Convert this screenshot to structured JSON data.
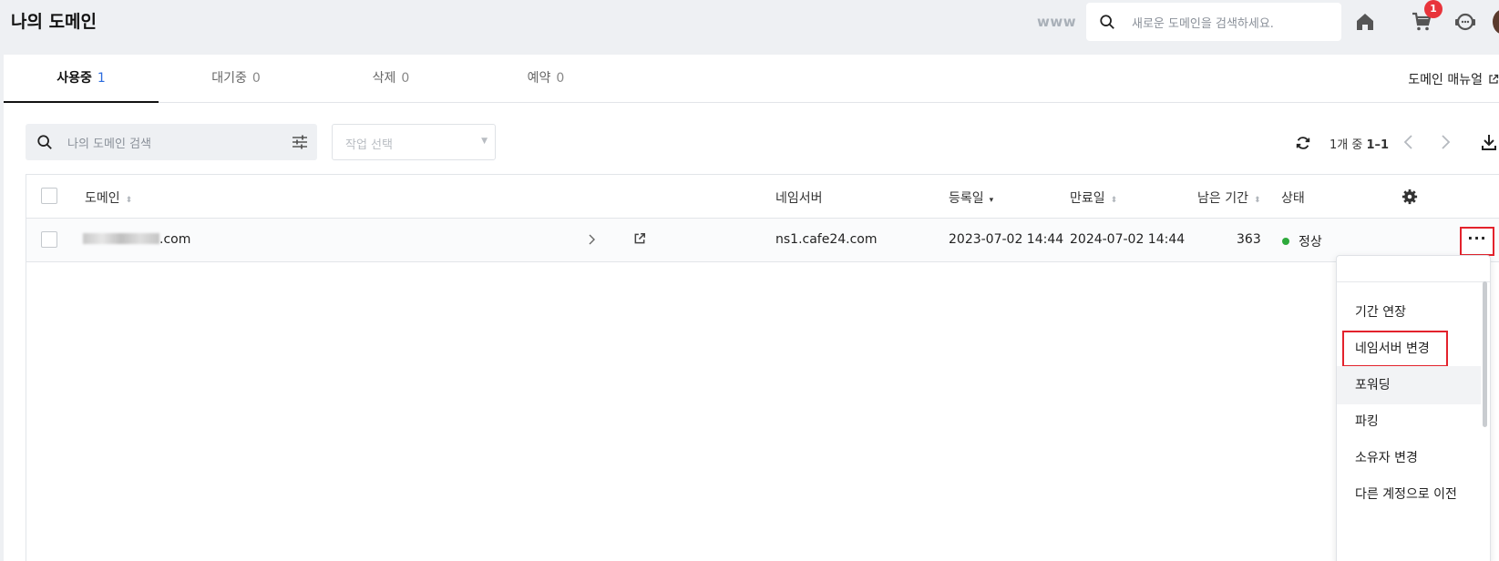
{
  "header": {
    "title": "나의 도메인",
    "www_label": "www",
    "search_placeholder": "새로운 도메인을 검색하세요.",
    "cart_badge": "1"
  },
  "tabs": [
    {
      "label": "사용중",
      "count": "1",
      "active": true
    },
    {
      "label": "대기중",
      "count": "0",
      "active": false
    },
    {
      "label": "삭제",
      "count": "0",
      "active": false
    },
    {
      "label": "예약",
      "count": "0",
      "active": false
    }
  ],
  "manual_link": "도메인 매뉴얼",
  "toolbar": {
    "filter_placeholder": "나의 도메인 검색",
    "action_placeholder": "작업 선택",
    "page_info_prefix": "1개 중 ",
    "page_info_range": "1–1"
  },
  "table": {
    "columns": {
      "domain": "도메인",
      "nameserver": "네임서버",
      "registered": "등록일",
      "expires": "만료일",
      "remaining": "남은 기간",
      "status": "상태"
    },
    "rows": [
      {
        "domain_suffix": ".com",
        "nameserver": "ns1.cafe24.com",
        "registered": "2023-07-02 14:44",
        "expires": "2024-07-02 14:44",
        "remaining": "363",
        "status": "정상",
        "more_label": "···"
      }
    ]
  },
  "menu": {
    "items": [
      {
        "label": "기간 연장"
      },
      {
        "label": "네임서버 변경"
      },
      {
        "label": "포워딩"
      },
      {
        "label": "파킹"
      },
      {
        "label": "소유자 변경"
      },
      {
        "label": "다른 계정으로 이전"
      }
    ]
  },
  "colors": {
    "accent": "#2b6bde",
    "highlight_border": "#e3222c",
    "status_ok": "#2eaa3c",
    "badge": "#e8343b"
  }
}
